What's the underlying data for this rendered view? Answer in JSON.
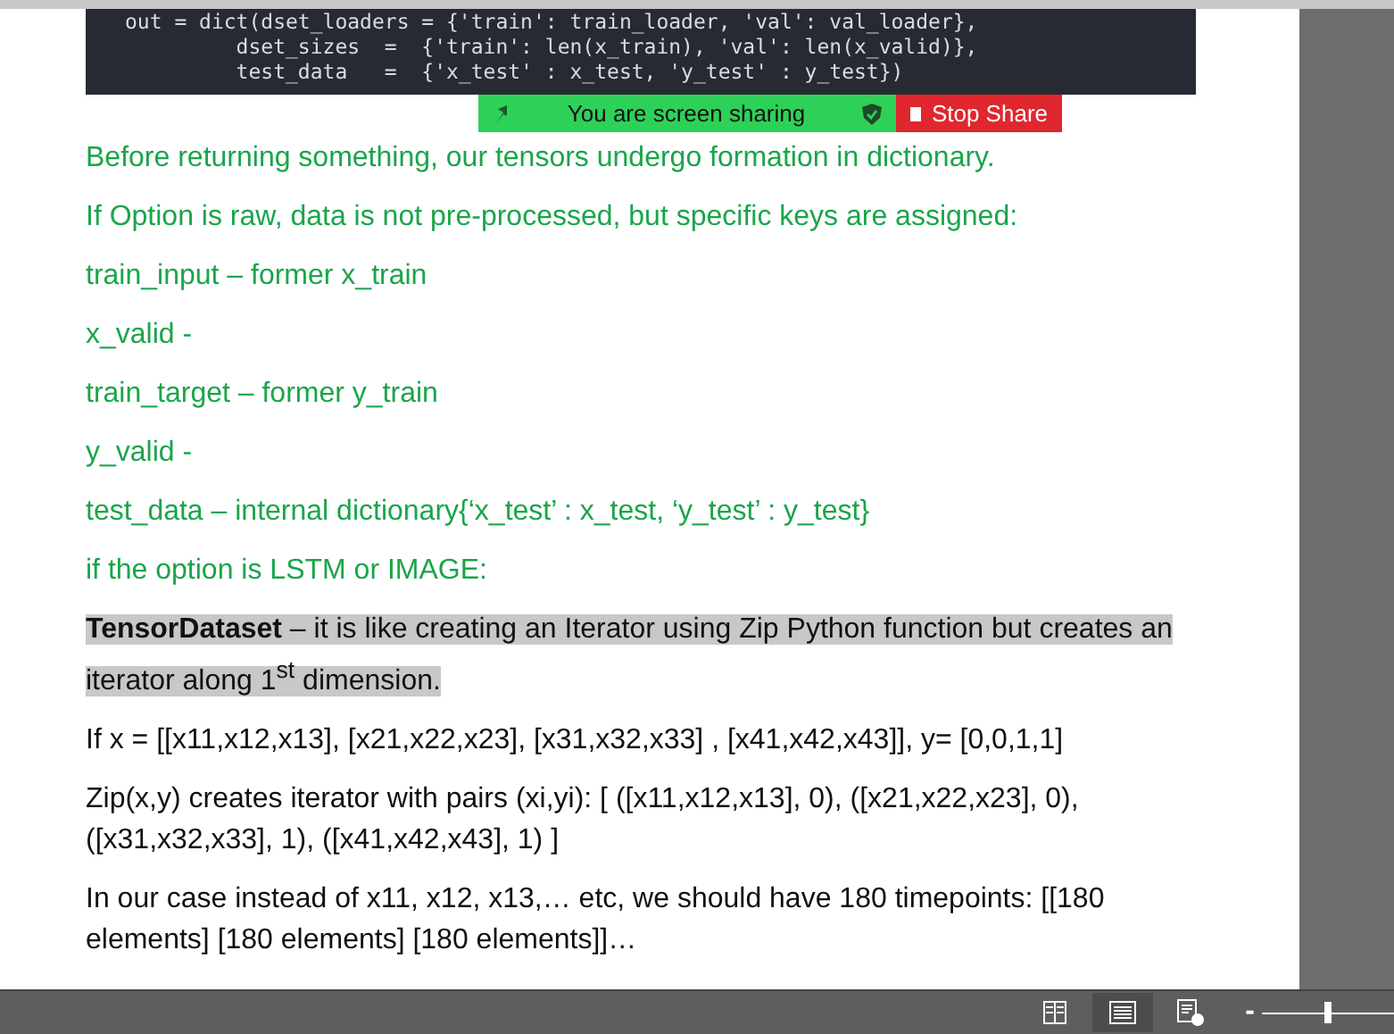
{
  "code_lines": [
    "out = dict(dset_loaders = {'train': train_loader, 'val': val_loader},",
    "         dset_sizes  =  {'train': len(x_train), 'val': len(x_valid)},",
    "         test_data   =  {'x_test' : x_test, 'y_test' : y_test})"
  ],
  "share_bar": {
    "message": "You are screen sharing",
    "stop_label": "Stop Share"
  },
  "paragraphs": [
    {
      "kind": "note",
      "text": "Before returning something, our tensors undergo formation in dictionary.",
      "highlighted": false
    },
    {
      "kind": "note",
      "text": "If Option is raw, data is not pre-processed, but specific keys are assigned:",
      "highlighted": false
    },
    {
      "kind": "note",
      "text": "train_input – former x_train",
      "highlighted": false
    },
    {
      "kind": "note",
      "text": "x_valid -",
      "highlighted": false
    },
    {
      "kind": "note",
      "text": "train_target – former y_train",
      "highlighted": false
    },
    {
      "kind": "note",
      "text": "y_valid -",
      "highlighted": false
    },
    {
      "kind": "note",
      "text": "test_data – internal dictionary{‘x_test’ : x_test, ‘y_test’ : y_test}",
      "highlighted": false
    },
    {
      "kind": "note",
      "text": "if the option is LSTM or IMAGE:",
      "highlighted": false
    },
    {
      "kind": "body",
      "text": "**TensorDataset** – it is like creating an Iterator using Zip Python function but creates an iterator along 1$^{st}$ dimension.",
      "highlighted": true
    },
    {
      "kind": "body",
      "text": "If x = [[x11,x12,x13], [x21,x22,x23], [x31,x32,x33] , [x41,x42,x43]], y= [0,0,1,1]",
      "highlighted": false
    },
    {
      "kind": "body",
      "text": "Zip(x,y) creates iterator with pairs (xi,yi): [ ([x11,x12,x13], 0), ([x21,x22,x23], 0), ([x31,x32,x33], 1), ([x41,x42,x43], 1) ]",
      "highlighted": false
    },
    {
      "kind": "body",
      "text": "In our case instead of x11, x12, x13,… etc, we should have 180 timepoints: [[180 elements] [180 elements] [180 elements]]…",
      "highlighted": false
    }
  ],
  "status_bar": {
    "views": [
      {
        "kind": "read",
        "selected": false
      },
      {
        "kind": "print",
        "selected": true
      },
      {
        "kind": "web",
        "selected": false
      }
    ],
    "zoom_out": "-",
    "zoom": {
      "level": 0.5
    }
  }
}
